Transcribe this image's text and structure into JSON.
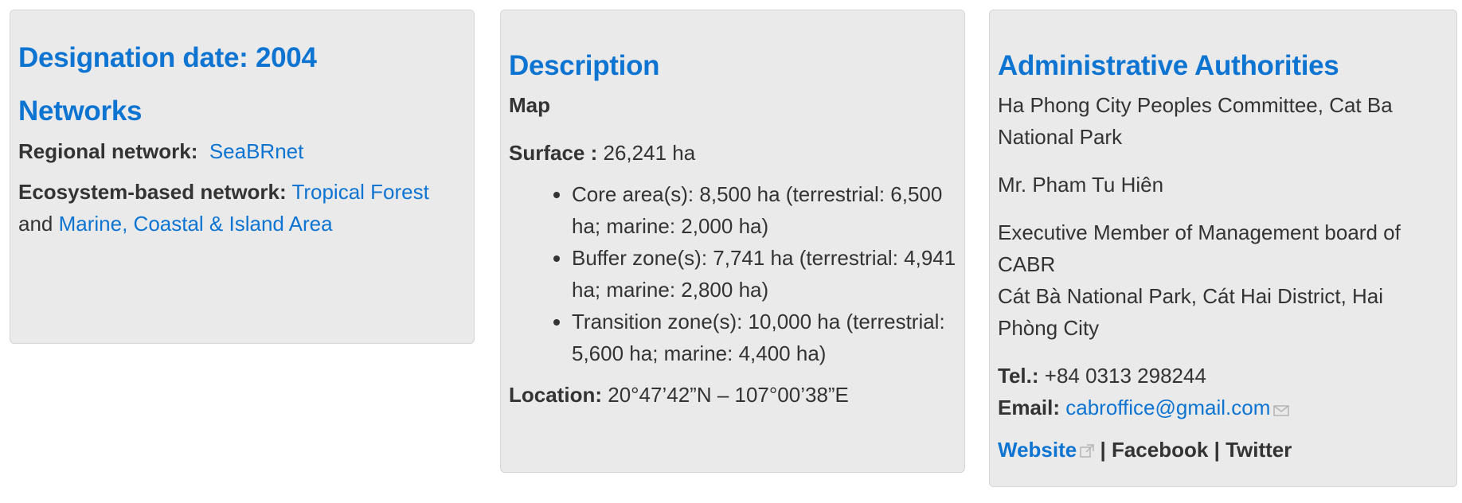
{
  "left_panel": {
    "designation_heading": "Designation date: 2004",
    "networks_heading": "Networks",
    "regional_label": "Regional network:",
    "regional_link": "SeaBRnet",
    "ecosystem_label": "Ecosystem-based network:",
    "ecosystem_link1": "Tropical Forest",
    "and_text": "and",
    "ecosystem_link2": "Marine, Coastal & Island Area"
  },
  "middle_panel": {
    "heading": "Description",
    "map_label": "Map",
    "surface_label": "Surface :",
    "surface_value": "26,241 ha",
    "zones": [
      "Core area(s): 8,500 ha (terrestrial: 6,500 ha; marine: 2,000 ha)",
      "Buffer zone(s): 7,741 ha (terrestrial: 4,941 ha; marine: 2,800 ha)",
      "Transition zone(s): 10,000 ha (terrestrial: 5,600 ha; marine: 4,400 ha)"
    ],
    "location_label": "Location:",
    "location_value": "20°47’42”N – 107°00’38”E"
  },
  "right_panel": {
    "heading": "Administrative Authorities",
    "authority": "Ha Phong City Peoples Committee, Cat Ba National Park",
    "contact_name": "Mr. Pham Tu Hiên",
    "role": "Executive Member of Management board of CABR",
    "address": "Cát Bà National Park, Cát Hai District, Hai Phòng City",
    "tel_label": "Tel.:",
    "tel_value": "+84 0313 298244",
    "email_label": "Email:",
    "email_value": "cabroffice@gmail.com",
    "website_label": "Website",
    "separator": "|",
    "facebook_label": "Facebook",
    "twitter_label": "Twitter",
    "icons": [
      "envelope-icon",
      "external-link-icon"
    ],
    "link_color": "#0d74d1",
    "panel_color": "#eaeaeb"
  }
}
